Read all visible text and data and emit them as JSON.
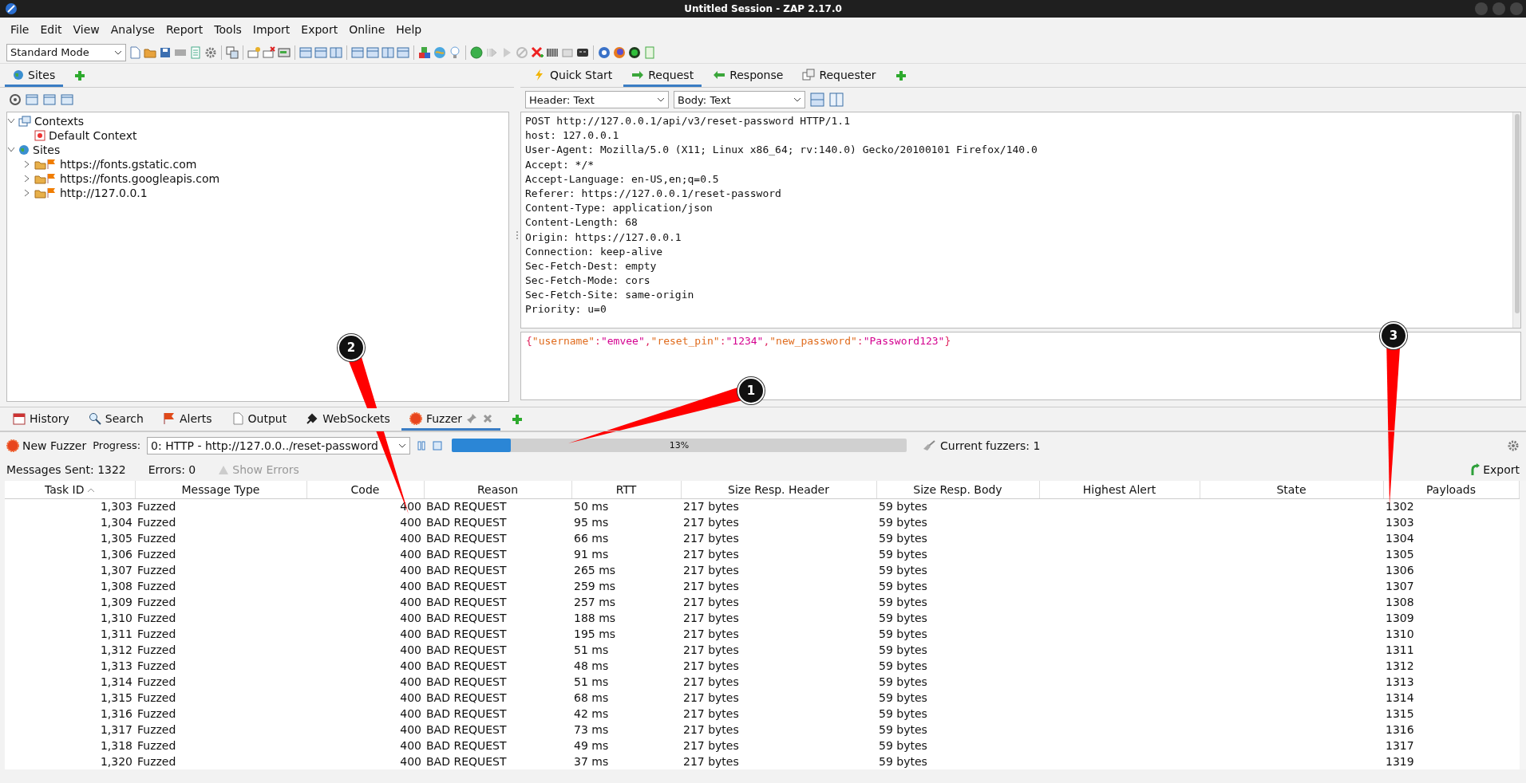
{
  "window": {
    "title": "Untitled Session - ZAP 2.17.0"
  },
  "menu": [
    "File",
    "Edit",
    "View",
    "Analyse",
    "Report",
    "Tools",
    "Import",
    "Export",
    "Online",
    "Help"
  ],
  "toolbar": {
    "mode": "Standard Mode"
  },
  "sites_panel": {
    "tabs": [
      {
        "label": "Sites",
        "selected": true
      }
    ],
    "tree": [
      {
        "label": "Contexts",
        "kind": "contexts",
        "expanded": true,
        "children": [
          {
            "label": "Default Context",
            "kind": "context"
          }
        ]
      },
      {
        "label": "Sites",
        "kind": "sites",
        "expanded": true,
        "children": [
          {
            "label": "https://fonts.gstatic.com",
            "kind": "site",
            "expanded": false
          },
          {
            "label": "https://fonts.googleapis.com",
            "kind": "site",
            "expanded": false
          },
          {
            "label": "http://127.0.0.1",
            "kind": "site",
            "expanded": false
          }
        ]
      }
    ]
  },
  "request_panel": {
    "tabs": [
      {
        "label": "Quick Start",
        "kind": "bolt",
        "selected": false
      },
      {
        "label": "Request",
        "kind": "arrow-right",
        "selected": true
      },
      {
        "label": "Response",
        "kind": "arrow-left",
        "selected": false
      },
      {
        "label": "Requester",
        "kind": "windows",
        "selected": false
      }
    ],
    "header_view": "Header: Text",
    "body_view": "Body: Text",
    "header_lines": [
      "POST http://127.0.0.1/api/v3/reset-password HTTP/1.1",
      "host: 127.0.0.1",
      "User-Agent: Mozilla/5.0 (X11; Linux x86_64; rv:140.0) Gecko/20100101 Firefox/140.0",
      "Accept: */*",
      "Accept-Language: en-US,en;q=0.5",
      "Referer: https://127.0.0.1/reset-password",
      "Content-Type: application/json",
      "Content-Length: 68",
      "Origin: https://127.0.0.1",
      "Connection: keep-alive",
      "Sec-Fetch-Dest: empty",
      "Sec-Fetch-Mode: cors",
      "Sec-Fetch-Site: same-origin",
      "Priority: u=0"
    ],
    "body_tokens": [
      {
        "text": "{",
        "kind": "punct"
      },
      {
        "text": "\"username\"",
        "kind": "key"
      },
      {
        "text": ":",
        "kind": "punct"
      },
      {
        "text": "\"emvee\"",
        "kind": "value"
      },
      {
        "text": ",",
        "kind": "punct"
      },
      {
        "text": "\"reset_pin\"",
        "kind": "key"
      },
      {
        "text": ":",
        "kind": "punct"
      },
      {
        "text": "\"1234\"",
        "kind": "value"
      },
      {
        "text": ",",
        "kind": "punct"
      },
      {
        "text": "\"new_password\"",
        "kind": "key"
      },
      {
        "text": ":",
        "kind": "punct"
      },
      {
        "text": "\"Password123\"",
        "kind": "value"
      },
      {
        "text": "}",
        "kind": "punct"
      }
    ]
  },
  "bottom_panel": {
    "tabs": [
      {
        "label": "History",
        "kind": "calendar",
        "selected": false
      },
      {
        "label": "Search",
        "kind": "search",
        "selected": false
      },
      {
        "label": "Alerts",
        "kind": "flag",
        "selected": false
      },
      {
        "label": "Output",
        "kind": "page",
        "selected": false
      },
      {
        "label": "WebSockets",
        "kind": "plug",
        "selected": false
      },
      {
        "label": "Fuzzer",
        "kind": "fuzzer",
        "selected": true
      }
    ],
    "fuzzer": {
      "new_fuzzer": "New Fuzzer",
      "progress_label": "Progress:",
      "selection": "0: HTTP - http://127.0.0../reset-password",
      "progress": {
        "level": 0.13,
        "reading": "13%"
      },
      "current_fuzzers": "Current fuzzers: 1",
      "messages_sent": "Messages Sent: 1322",
      "errors": "Errors: 0",
      "show_errors": {
        "label": "Show Errors",
        "disabled": true
      },
      "export": "Export"
    },
    "table": {
      "columns": [
        {
          "label": "Task ID",
          "sorted": true
        },
        {
          "label": "Message Type",
          "sorted": false
        },
        {
          "label": "Code",
          "sorted": false
        },
        {
          "label": "Reason",
          "sorted": false
        },
        {
          "label": "RTT",
          "sorted": false
        },
        {
          "label": "Size Resp. Header",
          "sorted": false
        },
        {
          "label": "Size Resp. Body",
          "sorted": false
        },
        {
          "label": "Highest Alert",
          "sorted": false
        },
        {
          "label": "State",
          "sorted": false
        },
        {
          "label": "Payloads",
          "sorted": false
        }
      ],
      "rows": [
        {
          "task_id": "1,303",
          "message_type": "Fuzzed",
          "code": "400",
          "reason": "BAD REQUEST",
          "rtt": "50 ms",
          "size_resp_header": "217 bytes",
          "size_resp_body": "59 bytes",
          "payloads": "1302"
        },
        {
          "task_id": "1,304",
          "message_type": "Fuzzed",
          "code": "400",
          "reason": "BAD REQUEST",
          "rtt": "95 ms",
          "size_resp_header": "217 bytes",
          "size_resp_body": "59 bytes",
          "payloads": "1303"
        },
        {
          "task_id": "1,305",
          "message_type": "Fuzzed",
          "code": "400",
          "reason": "BAD REQUEST",
          "rtt": "66 ms",
          "size_resp_header": "217 bytes",
          "size_resp_body": "59 bytes",
          "payloads": "1304"
        },
        {
          "task_id": "1,306",
          "message_type": "Fuzzed",
          "code": "400",
          "reason": "BAD REQUEST",
          "rtt": "91 ms",
          "size_resp_header": "217 bytes",
          "size_resp_body": "59 bytes",
          "payloads": "1305"
        },
        {
          "task_id": "1,307",
          "message_type": "Fuzzed",
          "code": "400",
          "reason": "BAD REQUEST",
          "rtt": "265 ms",
          "size_resp_header": "217 bytes",
          "size_resp_body": "59 bytes",
          "payloads": "1306"
        },
        {
          "task_id": "1,308",
          "message_type": "Fuzzed",
          "code": "400",
          "reason": "BAD REQUEST",
          "rtt": "259 ms",
          "size_resp_header": "217 bytes",
          "size_resp_body": "59 bytes",
          "payloads": "1307"
        },
        {
          "task_id": "1,309",
          "message_type": "Fuzzed",
          "code": "400",
          "reason": "BAD REQUEST",
          "rtt": "257 ms",
          "size_resp_header": "217 bytes",
          "size_resp_body": "59 bytes",
          "payloads": "1308"
        },
        {
          "task_id": "1,310",
          "message_type": "Fuzzed",
          "code": "400",
          "reason": "BAD REQUEST",
          "rtt": "188 ms",
          "size_resp_header": "217 bytes",
          "size_resp_body": "59 bytes",
          "payloads": "1309"
        },
        {
          "task_id": "1,311",
          "message_type": "Fuzzed",
          "code": "400",
          "reason": "BAD REQUEST",
          "rtt": "195 ms",
          "size_resp_header": "217 bytes",
          "size_resp_body": "59 bytes",
          "payloads": "1310"
        },
        {
          "task_id": "1,312",
          "message_type": "Fuzzed",
          "code": "400",
          "reason": "BAD REQUEST",
          "rtt": "51 ms",
          "size_resp_header": "217 bytes",
          "size_resp_body": "59 bytes",
          "payloads": "1311"
        },
        {
          "task_id": "1,313",
          "message_type": "Fuzzed",
          "code": "400",
          "reason": "BAD REQUEST",
          "rtt": "48 ms",
          "size_resp_header": "217 bytes",
          "size_resp_body": "59 bytes",
          "payloads": "1312"
        },
        {
          "task_id": "1,314",
          "message_type": "Fuzzed",
          "code": "400",
          "reason": "BAD REQUEST",
          "rtt": "51 ms",
          "size_resp_header": "217 bytes",
          "size_resp_body": "59 bytes",
          "payloads": "1313"
        },
        {
          "task_id": "1,315",
          "message_type": "Fuzzed",
          "code": "400",
          "reason": "BAD REQUEST",
          "rtt": "68 ms",
          "size_resp_header": "217 bytes",
          "size_resp_body": "59 bytes",
          "payloads": "1314"
        },
        {
          "task_id": "1,316",
          "message_type": "Fuzzed",
          "code": "400",
          "reason": "BAD REQUEST",
          "rtt": "42 ms",
          "size_resp_header": "217 bytes",
          "size_resp_body": "59 bytes",
          "payloads": "1315"
        },
        {
          "task_id": "1,317",
          "message_type": "Fuzzed",
          "code": "400",
          "reason": "BAD REQUEST",
          "rtt": "73 ms",
          "size_resp_header": "217 bytes",
          "size_resp_body": "59 bytes",
          "payloads": "1316"
        },
        {
          "task_id": "1,318",
          "message_type": "Fuzzed",
          "code": "400",
          "reason": "BAD REQUEST",
          "rtt": "49 ms",
          "size_resp_header": "217 bytes",
          "size_resp_body": "59 bytes",
          "payloads": "1317"
        },
        {
          "task_id": "1,320",
          "message_type": "Fuzzed",
          "code": "400",
          "reason": "BAD REQUEST",
          "rtt": "37 ms",
          "size_resp_header": "217 bytes",
          "size_resp_body": "59 bytes",
          "payloads": "1319"
        }
      ]
    }
  },
  "annotations": [
    {
      "number": "1"
    },
    {
      "number": "2"
    },
    {
      "number": "3"
    }
  ]
}
